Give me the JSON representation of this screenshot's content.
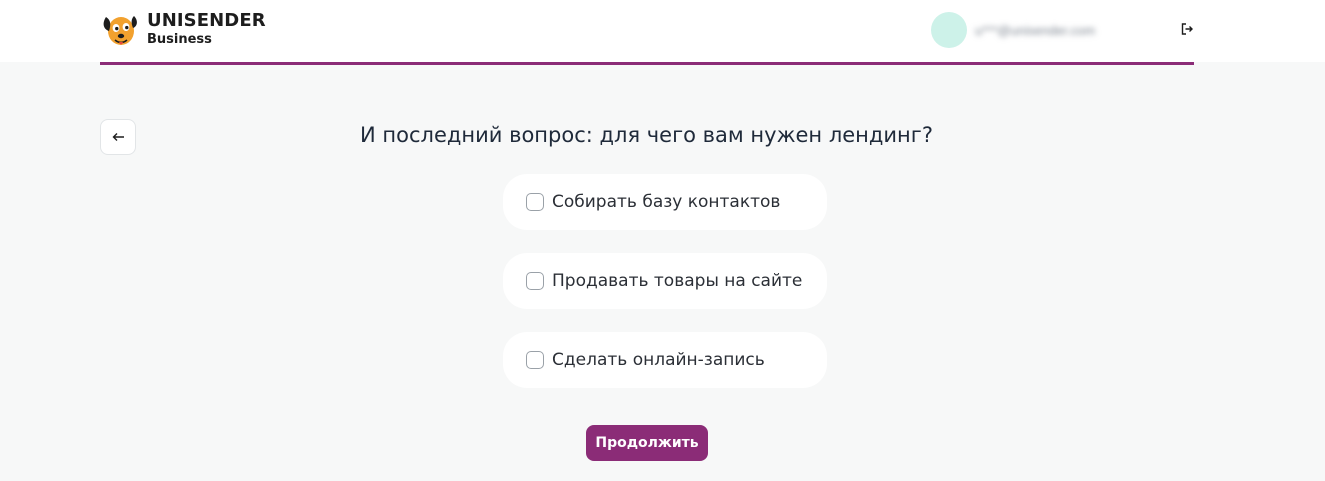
{
  "header": {
    "brand_name": "UNISENDER",
    "brand_sub": "Business",
    "user_email": "u***@unisender.com",
    "logout_icon": "logout-icon",
    "avatar_color": "#cdf2e9"
  },
  "accent_color": "#8b2c77",
  "nav": {
    "back_icon": "arrow-left-icon"
  },
  "question": {
    "title": "И последний вопрос: для чего вам нужен лендинг?",
    "options": [
      {
        "label": "Собирать базу контактов",
        "checked": false
      },
      {
        "label": "Продавать товары на сайте",
        "checked": false
      },
      {
        "label": "Сделать онлайн-запись",
        "checked": false
      }
    ]
  },
  "actions": {
    "continue_label": "Продолжить"
  }
}
